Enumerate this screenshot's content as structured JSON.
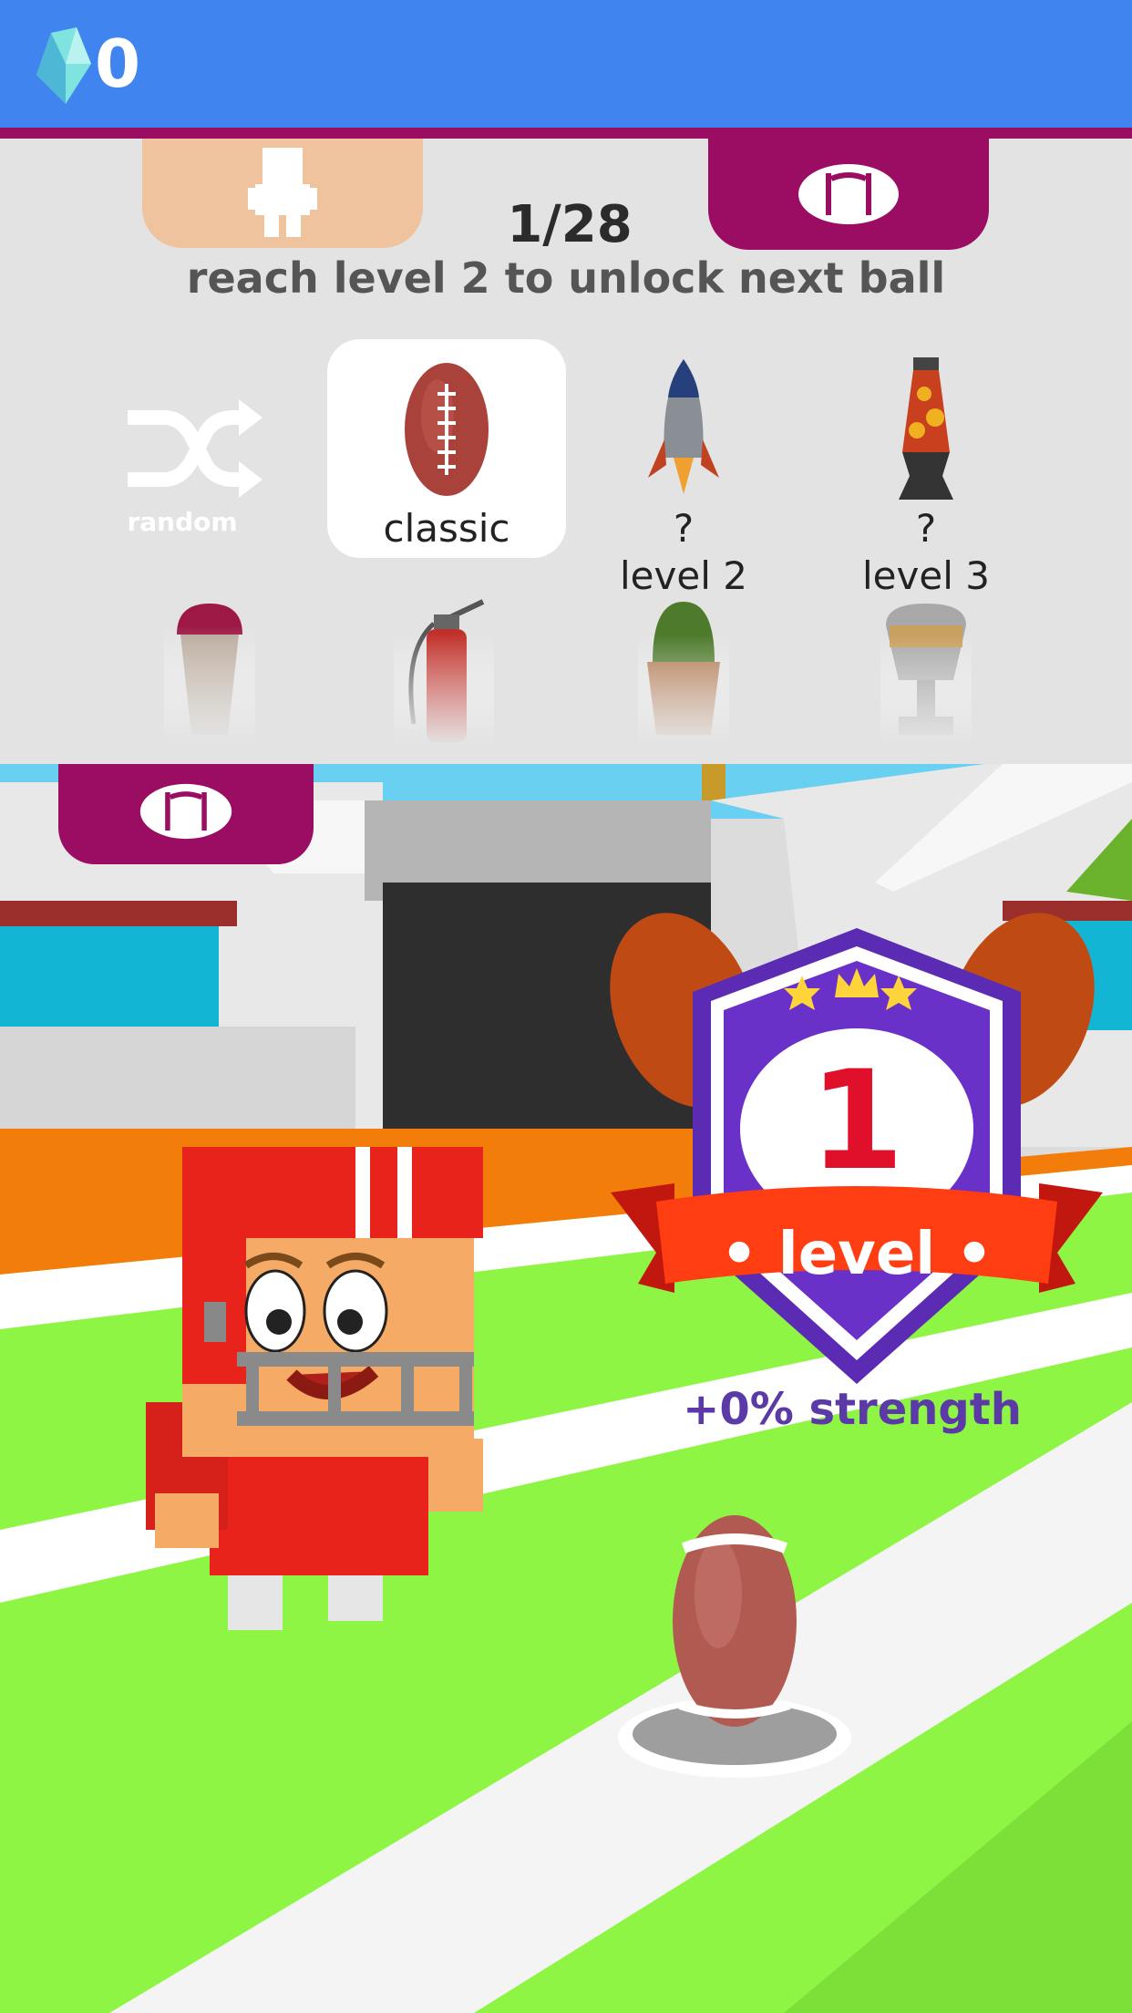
{
  "header": {
    "gem_count": "0",
    "gem_icon": "diamond-gem-icon"
  },
  "tabs": [
    {
      "name": "character",
      "icon": "character-icon"
    },
    {
      "name": "ball",
      "icon": "football-icon",
      "active": true
    }
  ],
  "progress": {
    "counter": "1/28",
    "message": "reach level 2 to unlock next ball"
  },
  "balls": [
    {
      "id": "random",
      "label": "random",
      "icon": "shuffle-icon"
    },
    {
      "id": "classic",
      "label": "classic",
      "selected": true
    },
    {
      "id": "rocket",
      "label": "?",
      "sub": "level 2"
    },
    {
      "id": "lava-lamp",
      "label": "?",
      "sub": "level 3"
    },
    {
      "id": "cupcake"
    },
    {
      "id": "extinguisher"
    },
    {
      "id": "cactus"
    },
    {
      "id": "trophy-cup"
    }
  ],
  "scene": {
    "ball_tab_icon": "football-icon"
  },
  "badge": {
    "level_number": "1",
    "level_word": "• level •",
    "strength": "+0% strength"
  },
  "colors": {
    "topbar": "#3f84ef",
    "accent": "#9b0d62",
    "badge_purple": "#5b2bb3",
    "ribbon": "#ff3d12"
  }
}
